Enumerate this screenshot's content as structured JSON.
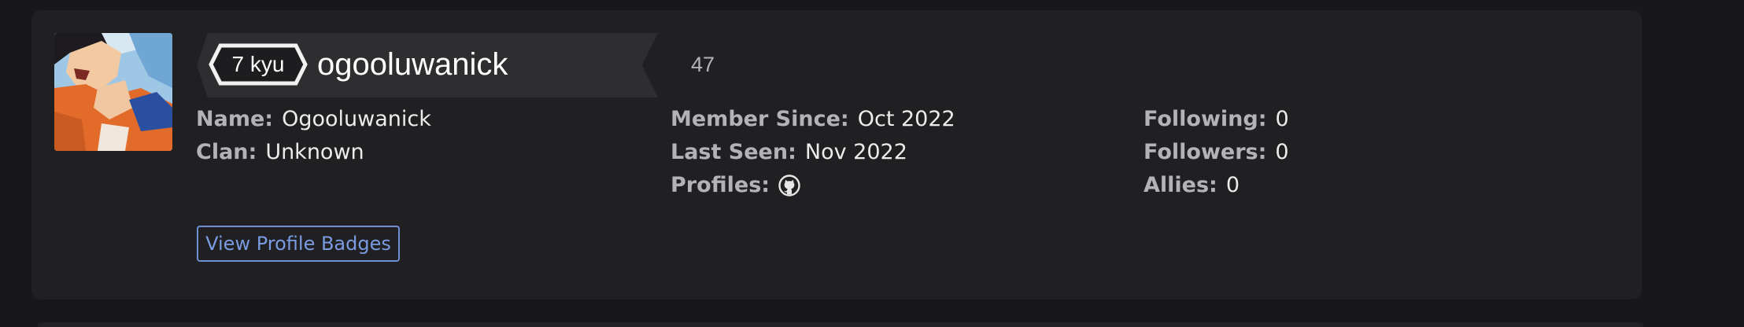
{
  "profile": {
    "rank": "7 kyu",
    "username": "ogooluwanick",
    "honor": "47",
    "avatar_icon": "anime-character-avatar"
  },
  "details": {
    "name_label": "Name:",
    "name_value": "Ogooluwanick",
    "clan_label": "Clan:",
    "clan_value": "Unknown",
    "member_since_label": "Member Since:",
    "member_since_value": "Oct 2022",
    "last_seen_label": "Last Seen:",
    "last_seen_value": "Nov 2022",
    "profiles_label": "Profiles:",
    "profiles_icon": "github-icon",
    "following_label": "Following:",
    "following_value": "0",
    "followers_label": "Followers:",
    "followers_value": "0",
    "allies_label": "Allies:",
    "allies_value": "0"
  },
  "actions": {
    "view_badges_label": "View Profile Badges"
  },
  "colors": {
    "page_bg": "#18181b",
    "card_bg": "#202023",
    "banner_bg": "#2e2e31",
    "label": "#b3b3b5",
    "value": "#ececec",
    "button_accent": "#7a9be0"
  }
}
